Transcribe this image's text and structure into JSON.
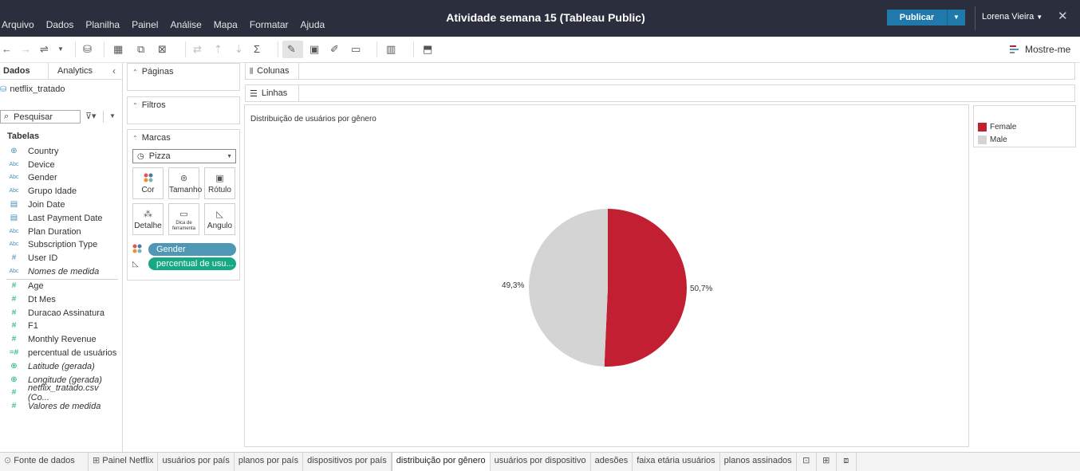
{
  "app": {
    "title": "Atividade semana 15 (Tableau Public)",
    "menu": [
      "Arquivo",
      "Dados",
      "Planilha",
      "Painel",
      "Análise",
      "Mapa",
      "Formatar",
      "Ajuda"
    ],
    "publish_label": "Publicar",
    "user_name": "Lorena Vieira",
    "accent_color": "#1f7aab",
    "topbar_color": "#2a2e3d"
  },
  "toolbar": {
    "show_me_label": "Mostre-me",
    "icons": [
      "back-icon",
      "forward-icon",
      "redo-icon",
      "new-datasource-icon",
      "new-worksheet-icon",
      "duplicate-sheet-icon",
      "clear-sheet-icon",
      "swap-icon",
      "sort-ascending-icon",
      "sort-descending-icon",
      "totals-icon",
      "highlight-icon",
      "labels-icon",
      "annotate-icon",
      "fit-icon",
      "cards-icon",
      "presentation-icon"
    ]
  },
  "data_pane": {
    "tab_data": "Dados",
    "tab_analytics": "Analytics",
    "datasource": "netflix_tratado",
    "search_placeholder": "Pesquisar",
    "tables_heading": "Tabelas",
    "dimensions": [
      {
        "type": "globe",
        "name": "Country"
      },
      {
        "type": "abc",
        "name": "Device"
      },
      {
        "type": "abc",
        "name": "Gender"
      },
      {
        "type": "abc",
        "name": "Grupo Idade"
      },
      {
        "type": "cal",
        "name": "Join Date"
      },
      {
        "type": "cal",
        "name": "Last Payment Date"
      },
      {
        "type": "abc",
        "name": "Plan Duration"
      },
      {
        "type": "abc",
        "name": "Subscription Type"
      },
      {
        "type": "num-blue",
        "name": "User ID"
      },
      {
        "type": "abc",
        "name": "Nomes de medida",
        "italic": true
      }
    ],
    "measures": [
      {
        "type": "num",
        "name": "Age"
      },
      {
        "type": "num",
        "name": "Dt Mes"
      },
      {
        "type": "num",
        "name": "Duracao Assinatura"
      },
      {
        "type": "num",
        "name": "F1"
      },
      {
        "type": "num",
        "name": "Monthly Revenue"
      },
      {
        "type": "calc",
        "name": "percentual de usuários"
      },
      {
        "type": "globe",
        "name": "Latitude (gerada)",
        "italic": true
      },
      {
        "type": "globe",
        "name": "Longitude (gerada)",
        "italic": true
      },
      {
        "type": "num",
        "name": "netflix_tratado.csv (Co...",
        "italic": true
      },
      {
        "type": "num",
        "name": "Valores de medida",
        "italic": true
      }
    ],
    "abc_text": "Abc"
  },
  "cards": {
    "pages": "Páginas",
    "filters": "Filtros",
    "marks": "Marcas",
    "mark_type": "Pizza",
    "mark_buttons": [
      "Cor",
      "Tamanho",
      "Rótulo",
      "Detalhe",
      "Dica de ferramenta",
      "Angulo"
    ],
    "pills": [
      {
        "label": "Gender",
        "color": "#4f97b4"
      },
      {
        "label": "percentual de usu... △",
        "color": "#17a886"
      }
    ]
  },
  "shelves": {
    "columns": "Colunas",
    "rows": "Linhas"
  },
  "view": {
    "title": "Distribuição de usuários por gênero"
  },
  "chart_data": {
    "type": "pie",
    "title": "Distribuição de usuários por gênero",
    "categories": [
      "Female",
      "Male"
    ],
    "values": [
      50.7,
      49.3
    ],
    "labels": [
      "50,7%",
      "49,3%"
    ],
    "colors": [
      "#c21f32",
      "#d4d4d4"
    ],
    "legend_position": "right"
  },
  "bottom_tabs": {
    "datasource": "Fonte de dados",
    "sheets": [
      "Painel Netflix",
      "usuários por país",
      "planos por país",
      "dispositivos por país",
      "distribuição por gênero",
      "usuários por dispositivo",
      "adesões",
      "faixa etária usuários",
      "planos assinados"
    ],
    "active_sheet": "distribuição por gênero"
  }
}
